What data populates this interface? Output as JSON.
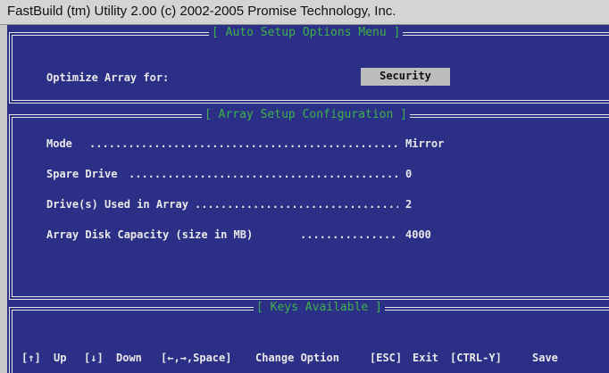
{
  "window": {
    "title": "FastBuild (tm) Utility 2.00 (c) 2002-2005 Promise Technology, Inc."
  },
  "auto_setup": {
    "title": "[ Auto Setup Options Menu ]",
    "optimize_label": "Optimize Array for:",
    "optimize_value": "Security"
  },
  "array_config": {
    "title": "[ Array Setup Configuration ]",
    "rows": [
      {
        "label": "Mode",
        "value": "Mirror"
      },
      {
        "label": "Spare Drive",
        "value": "0"
      },
      {
        "label": "Drive(s) Used in Array",
        "value": "2"
      },
      {
        "label": "Array Disk Capacity (size in MB)",
        "value": "4000"
      }
    ]
  },
  "keys": {
    "title": "[ Keys Available ]",
    "items": [
      {
        "key": "[↑]",
        "action": "Up"
      },
      {
        "key": "[↓]",
        "action": "Down"
      },
      {
        "key": "[←,→,Space]",
        "action": "Change Option"
      },
      {
        "key": "[ESC]",
        "action": "Exit"
      },
      {
        "key": "[CTRL-Y]",
        "action": "Save"
      }
    ]
  },
  "colors": {
    "background": "#2b2f86",
    "panel_title": "#3fb34a",
    "text": "#e8e8e8",
    "selection": "#bdbdbd"
  }
}
